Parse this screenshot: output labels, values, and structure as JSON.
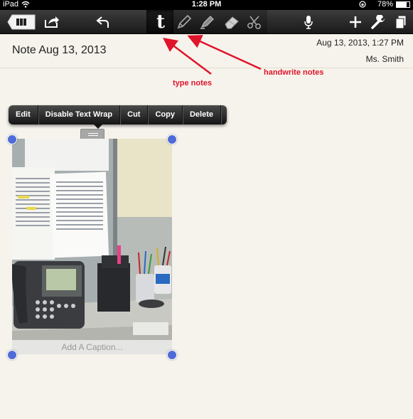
{
  "status_bar": {
    "carrier": "iPad",
    "time": "1:28 PM",
    "battery": "78%"
  },
  "toolbar": {
    "notebooks_icon": "notebooks-icon",
    "share_icon": "share-icon",
    "undo_icon": "undo-icon",
    "type_tool_label": "t",
    "pen_icon": "pen-icon",
    "highlighter_icon": "highlighter-icon",
    "eraser_icon": "eraser-icon",
    "scissors_icon": "scissors-icon",
    "mic_icon": "microphone-icon",
    "add_icon": "plus-icon",
    "settings_icon": "wrench-icon",
    "pages_icon": "pages-icon"
  },
  "note": {
    "title": "Note Aug 13, 2013",
    "date": "Aug 13, 2013, 1:27 PM",
    "author": "Ms. Smith"
  },
  "annotations": {
    "type_notes": "type notes",
    "handwrite_notes": "handwrite notes"
  },
  "context_menu": {
    "items": [
      "Edit",
      "Disable Text Wrap",
      "Cut",
      "Copy",
      "Delete"
    ]
  },
  "image": {
    "caption_placeholder": "Add A Caption..."
  },
  "colors": {
    "accent_handles": "#4f6bd8",
    "annotation_red": "#e0142a"
  }
}
